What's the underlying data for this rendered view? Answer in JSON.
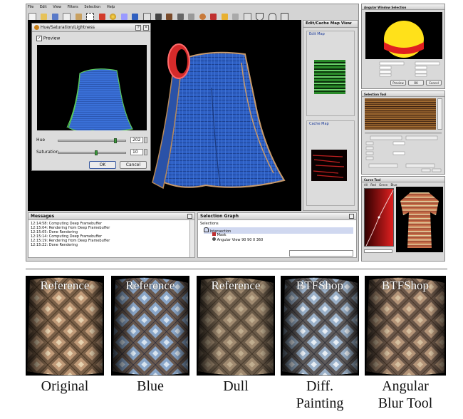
{
  "menubar": {
    "items": [
      "File",
      "Edit",
      "View",
      "Filters",
      "Selection",
      "Help"
    ]
  },
  "hsl_dialog": {
    "title": "Hue/Saturation/Lightness",
    "preview_label": "Preview",
    "hue_label": "Hue",
    "hue_value": "202",
    "saturation_label": "Saturation",
    "saturation_value": "10",
    "ok_label": "OK",
    "cancel_label": "Cancel"
  },
  "edit_cache_panel": {
    "title": "Edit/Cache Map View",
    "edit_map_label": "Edit Map",
    "cache_map_label": "Cache Map"
  },
  "messages_panel": {
    "title": "Messages",
    "lines": [
      "12:14:58: Computing Deep Framebuffer",
      "12:15:04: Rendering from Deep Framebuffer",
      "12:15:05: Done Rendering",
      "12:15:14: Computing Deep Framebuffer",
      "12:15:19: Rendering from Deep Framebuffer",
      "12:15:22: Done Rendering"
    ]
  },
  "selection_graph": {
    "title": "Selection Graph",
    "root_label": "Selections",
    "nodes": [
      "Intersection",
      "Mask",
      "Angular View 90 90 0 360"
    ]
  },
  "right_panels": {
    "angular_title": "Angular Window Selection",
    "angular_buttons": [
      "Preview",
      "OK",
      "Cancel"
    ],
    "selection_tool_title": "Selection Tool",
    "curve_title": "Curve Tool",
    "curve_tabs": [
      "All",
      "Red",
      "Green",
      "Blue"
    ]
  },
  "comparison": {
    "top_labels": [
      "Reference",
      "Reference",
      "Reference",
      "BTFShop",
      "BTFShop"
    ],
    "captions": [
      "Original",
      "Blue",
      "Dull",
      "Diff.\nPainting",
      "Angular\nBlur Tool"
    ]
  },
  "colors": {
    "cloth_blue": "#2d5fc4",
    "viewport_bg": "#000000",
    "highlight_red": "#d42a2a",
    "accent_green": "#2f9a2f"
  }
}
